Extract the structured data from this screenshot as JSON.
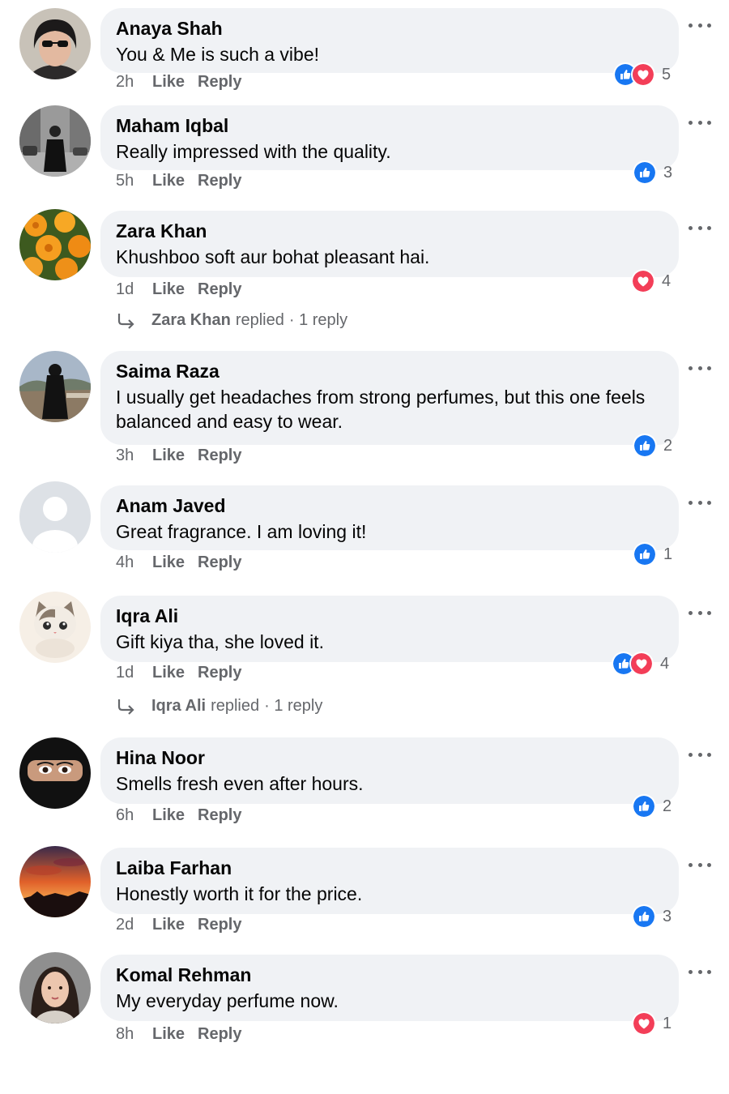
{
  "actions": {
    "like": "Like",
    "reply": "Reply"
  },
  "colors": {
    "like_blue": "#1877f2",
    "love_red": "#f33e58",
    "bubble": "#f0f2f5",
    "meta": "#65676b"
  },
  "comments": [
    {
      "name": "Anaya Shah",
      "text": "You & Me is such a vibe!",
      "time": "2h",
      "reactions": [
        "like",
        "love"
      ],
      "count": "5",
      "avatar": "woman-sunglasses-avatar"
    },
    {
      "name": "Maham Iqbal",
      "text": "Really impressed with the quality.",
      "time": "5h",
      "reactions": [
        "like"
      ],
      "count": "3",
      "avatar": "street-photo-avatar"
    },
    {
      "name": "Zara Khan",
      "text": "Khushboo soft aur bohat pleasant hai.",
      "time": "1d",
      "reactions": [
        "love"
      ],
      "count": "4",
      "avatar": "marigold-flowers-avatar",
      "reply": {
        "name": "Zara Khan",
        "text": "replied",
        "count": "· 1 reply"
      }
    },
    {
      "name": "Saima Raza",
      "text": "I usually get  headaches from strong perfumes, but this one feels balanced and easy to wear.",
      "time": "3h",
      "reactions": [
        "like"
      ],
      "count": "2",
      "avatar": "abaya-woman-avatar"
    },
    {
      "name": "Anam Javed",
      "text": "Great fragrance. I am loving it!",
      "time": "4h",
      "reactions": [
        "like"
      ],
      "count": "1",
      "avatar": "default-profile-avatar"
    },
    {
      "name": "Iqra Ali",
      "text": "Gift kiya tha, she loved it.",
      "time": "1d",
      "reactions": [
        "like",
        "love"
      ],
      "count": "4",
      "avatar": "cartoon-cat-avatar",
      "reply": {
        "name": "Iqra Ali",
        "text": "replied",
        "count": "· 1 reply"
      }
    },
    {
      "name": "Hina Noor",
      "text": "Smells fresh even after hours.",
      "time": "6h",
      "reactions": [
        "like"
      ],
      "count": "2",
      "avatar": "niqab-eyes-avatar"
    },
    {
      "name": "Laiba Farhan",
      "text": "Honestly worth it for the price.",
      "time": "2d",
      "reactions": [
        "like"
      ],
      "count": "3",
      "avatar": "sunset-avatar"
    },
    {
      "name": "Komal Rehman",
      "text": "My everyday perfume now.",
      "time": "8h",
      "reactions": [
        "love"
      ],
      "count": "1",
      "avatar": "woman-portrait-avatar"
    }
  ]
}
